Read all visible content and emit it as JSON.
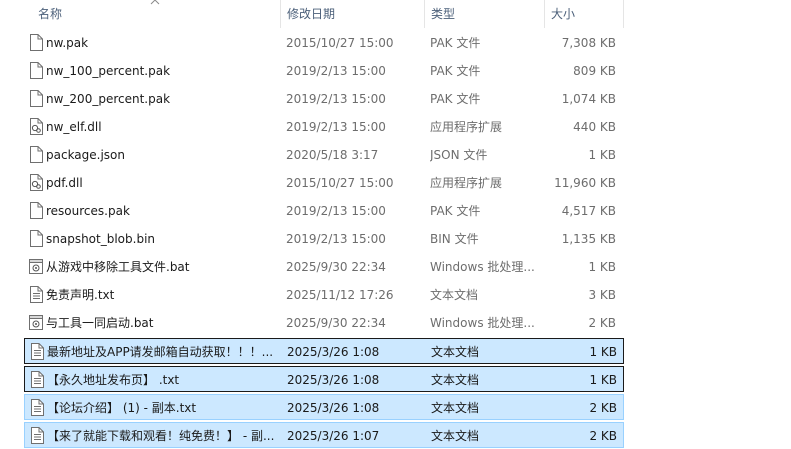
{
  "columns": {
    "name": "名称",
    "modified": "修改日期",
    "type": "类型",
    "size": "大小"
  },
  "files": [
    {
      "name": "nw.pak",
      "modified": "2015/10/27 15:00",
      "type": "PAK 文件",
      "size": "7,308 KB",
      "icon": "document-icon",
      "selected": false
    },
    {
      "name": "nw_100_percent.pak",
      "modified": "2019/2/13 15:00",
      "type": "PAK 文件",
      "size": "809 KB",
      "icon": "document-icon",
      "selected": false
    },
    {
      "name": "nw_200_percent.pak",
      "modified": "2019/2/13 15:00",
      "type": "PAK 文件",
      "size": "1,074 KB",
      "icon": "document-icon",
      "selected": false
    },
    {
      "name": "nw_elf.dll",
      "modified": "2019/2/13 15:00",
      "type": "应用程序扩展",
      "size": "440 KB",
      "icon": "dll-icon",
      "selected": false
    },
    {
      "name": "package.json",
      "modified": "2020/5/18 3:17",
      "type": "JSON 文件",
      "size": "1 KB",
      "icon": "document-icon",
      "selected": false
    },
    {
      "name": "pdf.dll",
      "modified": "2015/10/27 15:00",
      "type": "应用程序扩展",
      "size": "11,960 KB",
      "icon": "dll-icon",
      "selected": false
    },
    {
      "name": "resources.pak",
      "modified": "2019/2/13 15:00",
      "type": "PAK 文件",
      "size": "4,517 KB",
      "icon": "document-icon",
      "selected": false
    },
    {
      "name": "snapshot_blob.bin",
      "modified": "2019/2/13 15:00",
      "type": "BIN 文件",
      "size": "1,135 KB",
      "icon": "document-icon",
      "selected": false
    },
    {
      "name": "从游戏中移除工具文件.bat",
      "modified": "2025/9/30 22:34",
      "type": "Windows 批处理...",
      "size": "1 KB",
      "icon": "batch-file-icon",
      "selected": false
    },
    {
      "name": "免责声明.txt",
      "modified": "2025/11/12 17:26",
      "type": "文本文档",
      "size": "3 KB",
      "icon": "text-file-icon",
      "selected": false
    },
    {
      "name": "与工具一同启动.bat",
      "modified": "2025/9/30 22:34",
      "type": "Windows 批处理...",
      "size": "2 KB",
      "icon": "batch-file-icon",
      "selected": false
    },
    {
      "name": "最新地址及APP请发邮箱自动获取！！！...",
      "modified": "2025/3/26 1:08",
      "type": "文本文档",
      "size": "1 KB",
      "icon": "text-file-icon",
      "selected": true,
      "focus": true
    },
    {
      "name": "【永久地址发布页】 .txt",
      "modified": "2025/3/26 1:08",
      "type": "文本文档",
      "size": "1 KB",
      "icon": "text-file-icon",
      "selected": true,
      "focus": true
    },
    {
      "name": "【论坛介绍】 (1) - 副本.txt",
      "modified": "2025/3/26 1:08",
      "type": "文本文档",
      "size": "2 KB",
      "icon": "text-file-icon",
      "selected": true,
      "focus": false
    },
    {
      "name": "【来了就能下载和观看！纯免费！】 - 副...",
      "modified": "2025/3/26 1:07",
      "type": "文本文档",
      "size": "2 KB",
      "icon": "text-file-icon",
      "selected": true,
      "focus": false
    }
  ]
}
